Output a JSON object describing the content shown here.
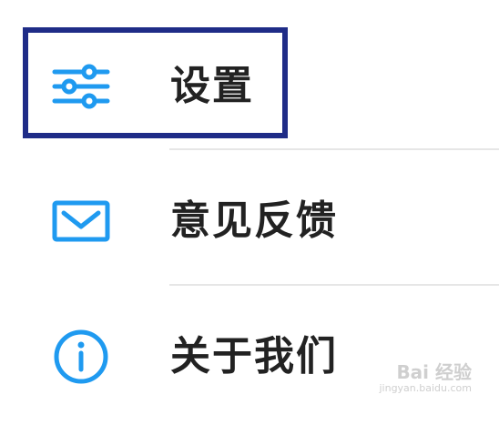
{
  "menu": {
    "items": [
      {
        "id": "settings",
        "label": "设置",
        "icon": "sliders-icon",
        "highlighted": true
      },
      {
        "id": "feedback",
        "label": "意见反馈",
        "icon": "mail-icon",
        "highlighted": false
      },
      {
        "id": "about",
        "label": "关于我们",
        "icon": "info-icon",
        "highlighted": false
      }
    ]
  },
  "colors": {
    "accent": "#1f9af0",
    "highlight_border": "#1f2c87",
    "text": "#222222",
    "divider": "#e6e6e6",
    "background": "#ffffff"
  },
  "watermark": {
    "brand": "Bai 经验",
    "domain": "jingyan.baidu.com"
  }
}
